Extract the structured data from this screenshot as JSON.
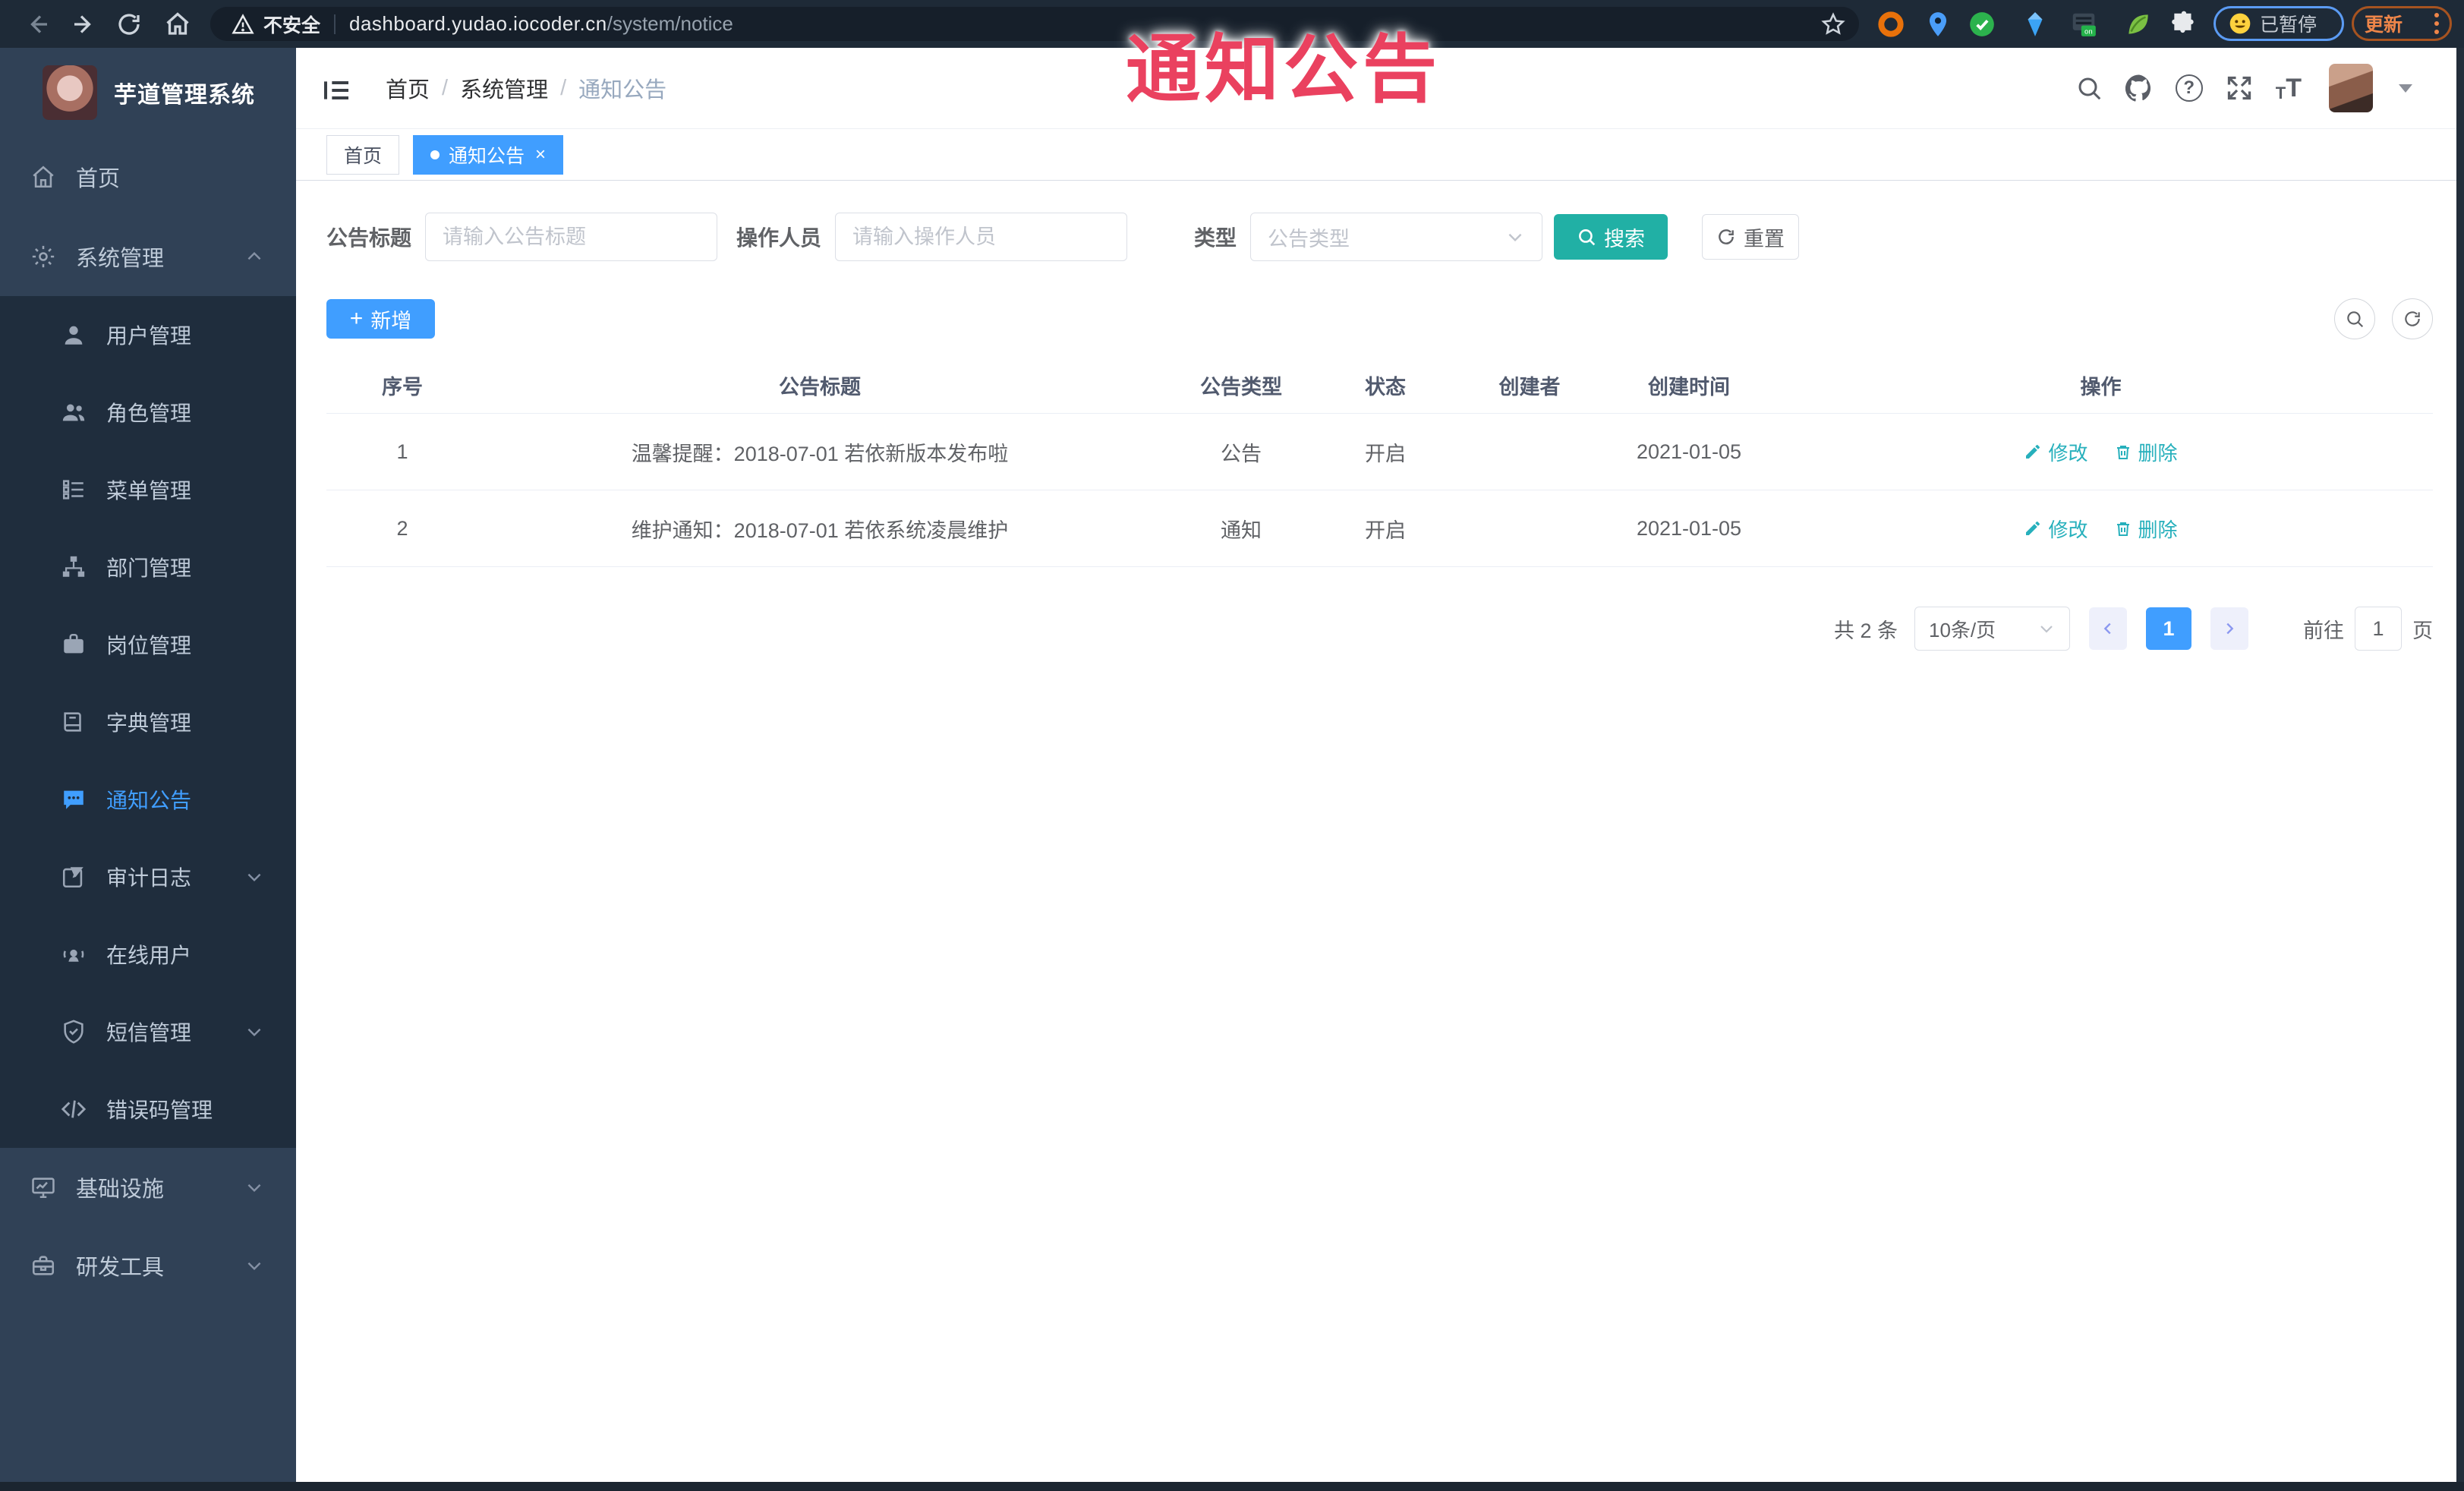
{
  "overlay_title": {
    "text": "通知公告",
    "color": "#ea415f"
  },
  "browser": {
    "insecure_label": "不安全",
    "url_domain": "dashboard.yudao.iocoder.cn",
    "url_path": "/system/notice",
    "paused_label": "已暂停",
    "update_label": "更新",
    "extension_icons": [
      "bookmark-star",
      "orange-ring",
      "location-pin",
      "green-circle",
      "blue-gem",
      "proxy-on-badge",
      "green-leaf",
      "puzzle-piece"
    ]
  },
  "sidebar": {
    "logo_title": "芋道管理系统",
    "items_top": [
      {
        "label": "首页"
      },
      {
        "label": "系统管理"
      }
    ],
    "submenu": [
      {
        "label": "用户管理"
      },
      {
        "label": "角色管理"
      },
      {
        "label": "菜单管理"
      },
      {
        "label": "部门管理"
      },
      {
        "label": "岗位管理"
      },
      {
        "label": "字典管理"
      },
      {
        "label": "通知公告"
      },
      {
        "label": "审计日志"
      },
      {
        "label": "在线用户"
      },
      {
        "label": "短信管理"
      },
      {
        "label": "错误码管理"
      }
    ],
    "items_bottom": [
      {
        "label": "基础设施"
      },
      {
        "label": "研发工具"
      }
    ]
  },
  "header": {
    "breadcrumb": [
      "首页",
      "系统管理",
      "通知公告"
    ]
  },
  "tabs": {
    "home": "首页",
    "active": "通知公告",
    "close": "×"
  },
  "filters": {
    "title_label": "公告标题",
    "title_placeholder": "请输入公告标题",
    "operator_label": "操作人员",
    "operator_placeholder": "请输入操作人员",
    "type_label": "类型",
    "type_placeholder": "公告类型",
    "search_label": "搜索",
    "reset_label": "重置"
  },
  "toolbar": {
    "add_label": "新增"
  },
  "table": {
    "columns": [
      "序号",
      "公告标题",
      "公告类型",
      "状态",
      "创建者",
      "创建时间",
      "操作"
    ],
    "rows": [
      {
        "no": "1",
        "title": "温馨提醒：2018-07-01 若依新版本发布啦",
        "type": "公告",
        "status": "开启",
        "creator": "",
        "created": "2021-01-05"
      },
      {
        "no": "2",
        "title": "维护通知：2018-07-01 若依系统凌晨维护",
        "type": "通知",
        "status": "开启",
        "creator": "",
        "created": "2021-01-05"
      }
    ],
    "edit_label": "修改",
    "delete_label": "删除"
  },
  "pagination": {
    "total": "共 2 条",
    "page_size": "10条/页",
    "page": "1",
    "goto_label": "前往",
    "goto_value": "1",
    "page_unit": "页"
  },
  "colors": {
    "primary": "#409eff",
    "teal": "#21b0a5",
    "sidebar_bg": "#304156",
    "submenu_bg": "#1f2d3d",
    "overlay_red": "#ea415f"
  }
}
